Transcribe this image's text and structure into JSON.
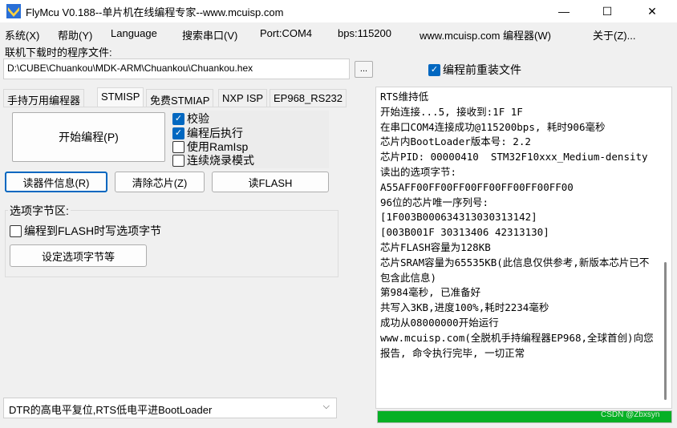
{
  "window": {
    "title": "FlyMcu V0.188--单片机在线编程专家--www.mcuisp.com",
    "controls": {
      "minimize": "—",
      "maximize": "☐",
      "close": "✕"
    }
  },
  "menu": [
    "系统(X)",
    "帮助(Y)",
    "Language",
    "搜索串口(V)",
    "Port:COM4",
    "bps:115200",
    "www.mcuisp.com 编程器(W)",
    "关于(Z)..."
  ],
  "file": {
    "label": "联机下载时的程序文件:",
    "path": "D:\\CUBE\\Chuankou\\MDK-ARM\\Chuankou\\Chuankou.hex",
    "browse_label": "...",
    "reload_label": "编程前重装文件",
    "reload_checked": true
  },
  "tabs": [
    "手持万用编程器",
    "STMISP",
    "免费STMIAP",
    "NXP ISP",
    "EP968_RS232"
  ],
  "active_tab": "STMISP",
  "stmisp": {
    "start_button": "开始编程(P)",
    "options": [
      {
        "label": "校验",
        "checked": true
      },
      {
        "label": "编程后执行",
        "checked": true
      },
      {
        "label": "使用RamIsp",
        "checked": false
      },
      {
        "label": "连续烧录模式",
        "checked": false
      }
    ],
    "read_info_button": "读器件信息(R)",
    "erase_button": "清除芯片(Z)",
    "read_flash_button": "读FLASH",
    "option_group_title": "选项字节区:",
    "flash_option_label": "编程到FLASH时写选项字节",
    "flash_option_checked": false,
    "set_option_button": "设定选项字节等"
  },
  "boot_mode": {
    "selected": "DTR的高电平复位,RTS低电平进BootLoader"
  },
  "log": {
    "lines": [
      "RTS维持低",
      "开始连接...5, 接收到:1F 1F",
      "在串口COM4连接成功@115200bps, 耗时906毫秒",
      "芯片内BootLoader版本号: 2.2",
      "芯片PID: 00000410  STM32F10xxx_Medium-density",
      "读出的选项字节:",
      "A55AFF00FF00FF00FF00FF00FF00FF00",
      "96位的芯片唯一序列号:",
      "[1F003B000634313030313142]",
      "[003B001F 30313406 42313130]",
      "芯片FLASH容量为128KB",
      "芯片SRAM容量为65535KB(此信息仅供参考,新版本芯片已不包含此信息)",
      "第984毫秒, 已准备好",
      "共写入3KB,进度100%,耗时2234毫秒",
      "成功从08000000开始运行",
      "www.mcuisp.com(全脱机手持编程器EP968,全球首创)向您报告, 命令执行完毕, 一切正常"
    ]
  },
  "progress": {
    "fraction": 1.0
  },
  "watermark": "CSDN @Zbxsyn",
  "colors": {
    "accent": "#0067c0",
    "progress": "#06b025"
  }
}
